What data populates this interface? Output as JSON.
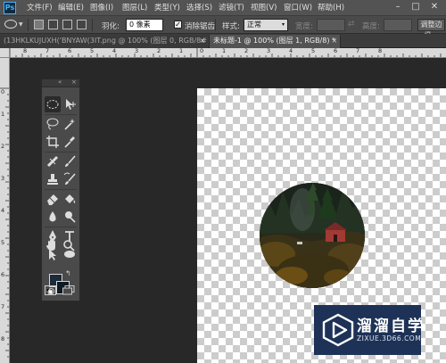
{
  "app": {
    "logo": "Ps"
  },
  "menubar": {
    "items": [
      "文件(F)",
      "编辑(E)",
      "图像(I)",
      "图层(L)",
      "类型(Y)",
      "选择(S)",
      "滤镜(T)",
      "视图(V)",
      "窗口(W)",
      "帮助(H)"
    ]
  },
  "options": {
    "feather_label": "羽化:",
    "feather_value": "0 像素",
    "antialias_label": "消除锯齿",
    "antialias_checked": true,
    "style_label": "样式:",
    "style_value": "正常",
    "width_label": "宽度:",
    "height_label": "高度:",
    "refine_edge_label": "调整边缘..."
  },
  "tabs": [
    {
      "label": "(13HKLKUJUXH('BNYAW(3IT.png @ 100% (图层 0, RGB/8#) *",
      "active": false
    },
    {
      "label": "未标题-1 @ 100% (图层 1, RGB/8) *",
      "active": true
    }
  ],
  "ruler_top_labels": [
    "8",
    "7",
    "6",
    "5",
    "4",
    "3",
    "2",
    "1",
    "0",
    "1",
    "2",
    "3",
    "4",
    "5",
    "6",
    "7",
    "8"
  ],
  "ruler_left_labels": [
    "0",
    "1",
    "2",
    "3",
    "4",
    "5",
    "6",
    "7",
    "8"
  ],
  "toolbox": {
    "tools": [
      "elliptical-marquee-icon",
      "move-icon",
      "lasso-icon",
      "magic-wand-icon",
      "crop-icon",
      "eyedropper-icon",
      "healing-brush-icon",
      "brush-icon",
      "clone-stamp-icon",
      "history-brush-icon",
      "eraser-icon",
      "paint-bucket-icon",
      "blur-icon",
      "dodge-icon",
      "pen-icon",
      "type-icon",
      "path-selection-icon",
      "ellipse-shape-icon",
      "hand-icon",
      "zoom-icon"
    ],
    "foreground_color": "#1c2a3a",
    "background_color": "#0e1a24"
  },
  "watermark": {
    "title": "溜溜自学",
    "url": "ZIXUE.3D66.COM"
  },
  "colors": {
    "menubar": "#535353",
    "optionsbar": "#4a4a4a",
    "workspace": "#282828",
    "ps_blue": "#4ab1f2",
    "watermark_bg": "#1d3256"
  }
}
